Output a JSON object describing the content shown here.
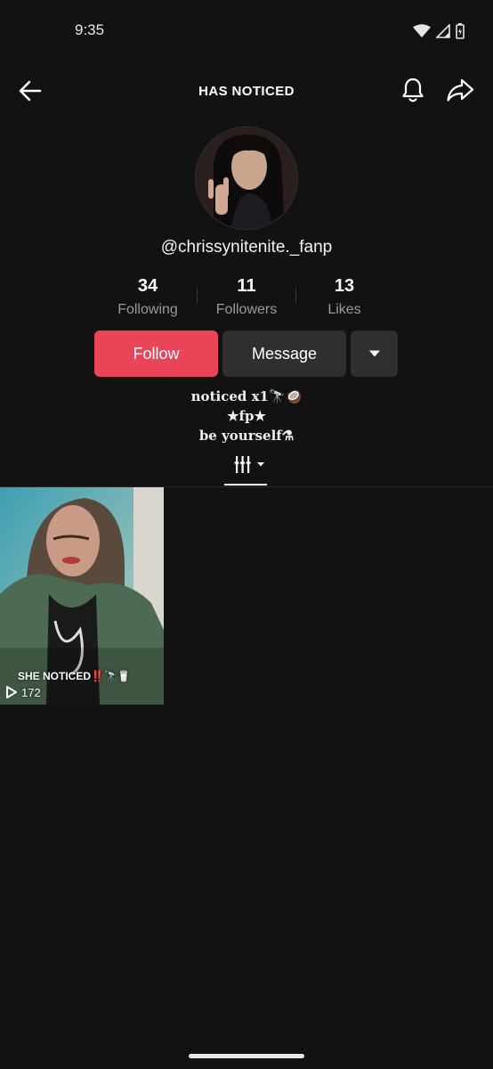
{
  "status_bar": {
    "time": "9:35"
  },
  "header": {
    "title": "HAS NOTICED"
  },
  "profile": {
    "username": "@chrissynitenite._fanp",
    "stats": [
      {
        "value": "34",
        "label": "Following"
      },
      {
        "value": "11",
        "label": "Followers"
      },
      {
        "value": "13",
        "label": "Likes"
      }
    ],
    "follow_label": "Follow",
    "message_label": "Message",
    "bio_lines": [
      "noticed x1🔭🥥",
      "★fp★",
      "be yourself⚗"
    ]
  },
  "videos": [
    {
      "caption": "SHE NOTICED‼️🔭🥛",
      "views": "172"
    }
  ],
  "colors": {
    "background": "#121212",
    "follow_accent": "#ea4459",
    "secondary_button": "#2f2f2f",
    "muted_text": "#9a9a9a"
  },
  "icons": {
    "back": "arrow-left-icon",
    "bell": "bell-icon",
    "share": "share-arrow-icon",
    "dropdown": "caret-down-icon",
    "tab": "grid-columns-icon",
    "play": "play-outline-icon"
  }
}
